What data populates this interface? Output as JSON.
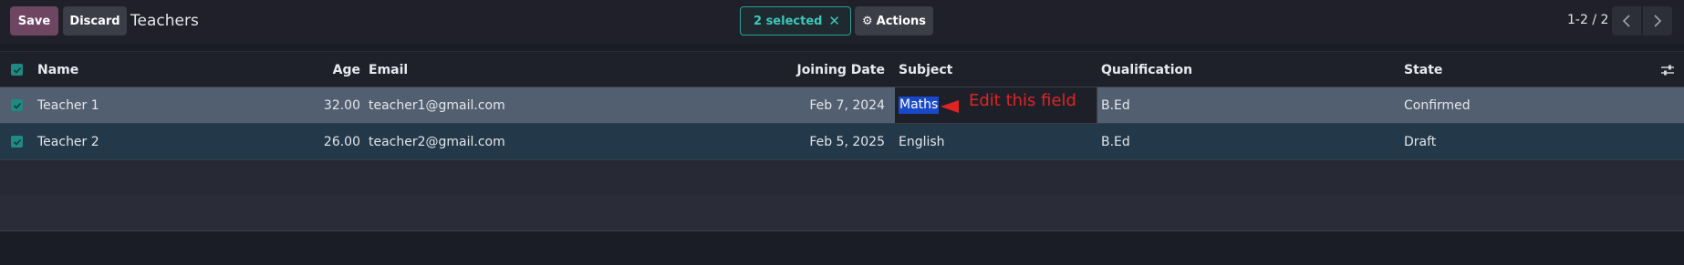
{
  "toolbar": {
    "save_label": "Save",
    "discard_label": "Discard",
    "title": "Teachers",
    "selected_label": "2 selected",
    "clear_icon": "close-icon",
    "actions_label": "Actions",
    "actions_icon": "gear-icon"
  },
  "pager": {
    "value": "1-2 / 2",
    "prev_icon": "chevron-left-icon",
    "next_icon": "chevron-right-icon"
  },
  "table": {
    "columns": [
      "Name",
      "Age",
      "Email",
      "Joining Date",
      "Subject",
      "Qualification",
      "State"
    ],
    "settings_icon": "sliders-icon",
    "rows": [
      {
        "selected": true,
        "name": "Teacher 1",
        "age": "32.00",
        "email": "teacher1@gmail.com",
        "joining_date": "Feb 7, 2024",
        "subject": "Maths",
        "qualification": "B.Ed",
        "state": "Confirmed"
      },
      {
        "selected": true,
        "name": "Teacher 2",
        "age": "26.00",
        "email": "teacher2@gmail.com",
        "joining_date": "Feb 5, 2025",
        "subject": "English",
        "qualification": "B.Ed",
        "state": "Draft"
      }
    ]
  },
  "annotation": {
    "text": "Edit this field",
    "color": "#e02424"
  },
  "colors": {
    "save_button": "#6f4662",
    "accent_teal": "#2aa198",
    "selection_highlight": "#1849c8",
    "row_active": "#525f70",
    "row_selected": "#233848"
  }
}
